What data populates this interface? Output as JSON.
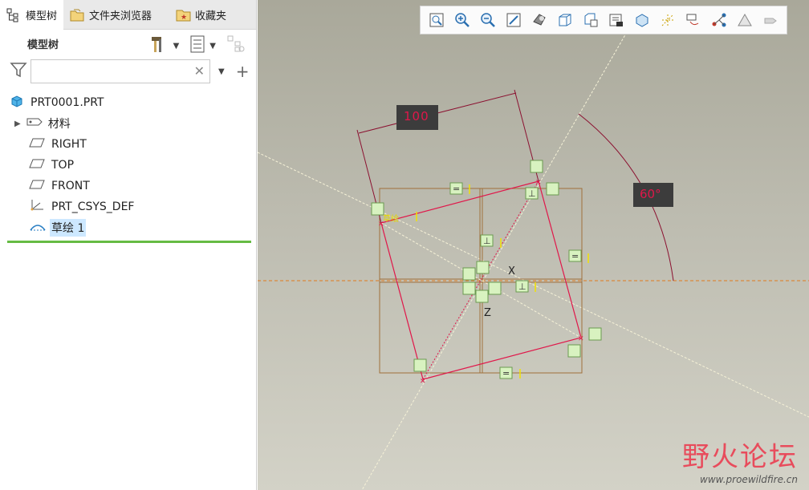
{
  "tabs": [
    {
      "label": "模型树",
      "icon": "model-tree-icon"
    },
    {
      "label": "文件夹浏览器",
      "icon": "folder-browser-icon"
    },
    {
      "label": "收藏夹",
      "icon": "favorites-icon"
    }
  ],
  "tree_header": {
    "title": "模型树"
  },
  "search": {
    "value": "",
    "placeholder": ""
  },
  "tree_items": [
    {
      "label": "PRT0001.PRT",
      "icon": "part-icon"
    },
    {
      "label": "材料",
      "icon": "material-icon"
    },
    {
      "label": "RIGHT",
      "icon": "datum-plane-icon"
    },
    {
      "label": "TOP",
      "icon": "datum-plane-icon"
    },
    {
      "label": "FRONT",
      "icon": "datum-plane-icon"
    },
    {
      "label": "PRT_CSYS_DEF",
      "icon": "csys-icon"
    },
    {
      "label": "草绘 1",
      "icon": "sketch-icon"
    }
  ],
  "toolbar_icons": [
    "zoom-fit-icon",
    "zoom-in-icon",
    "zoom-out-icon",
    "repaint-icon",
    "shaded-display-icon",
    "saved-view-icon",
    "view-manager-icon",
    "section-icon",
    "perspective-icon",
    "datum-display-icon",
    "annotation-display-icon",
    "spin-center-icon",
    "sketch-display-icon",
    "reorient-icon"
  ],
  "sketch": {
    "dimension_length": "100",
    "dimension_angle": "60°",
    "axis_x": "X",
    "axis_z": "Z",
    "sketch_label": "草绘"
  },
  "watermark": {
    "title": "野火论坛",
    "url": "www.proewildfire.cn"
  },
  "colors": {
    "sketch_line": "#e0174a",
    "box_line": "#a0703a",
    "dim_box": "#3c3c3c",
    "constraint_bg": "#d8f2c0",
    "accent_green": "#66bb44"
  }
}
